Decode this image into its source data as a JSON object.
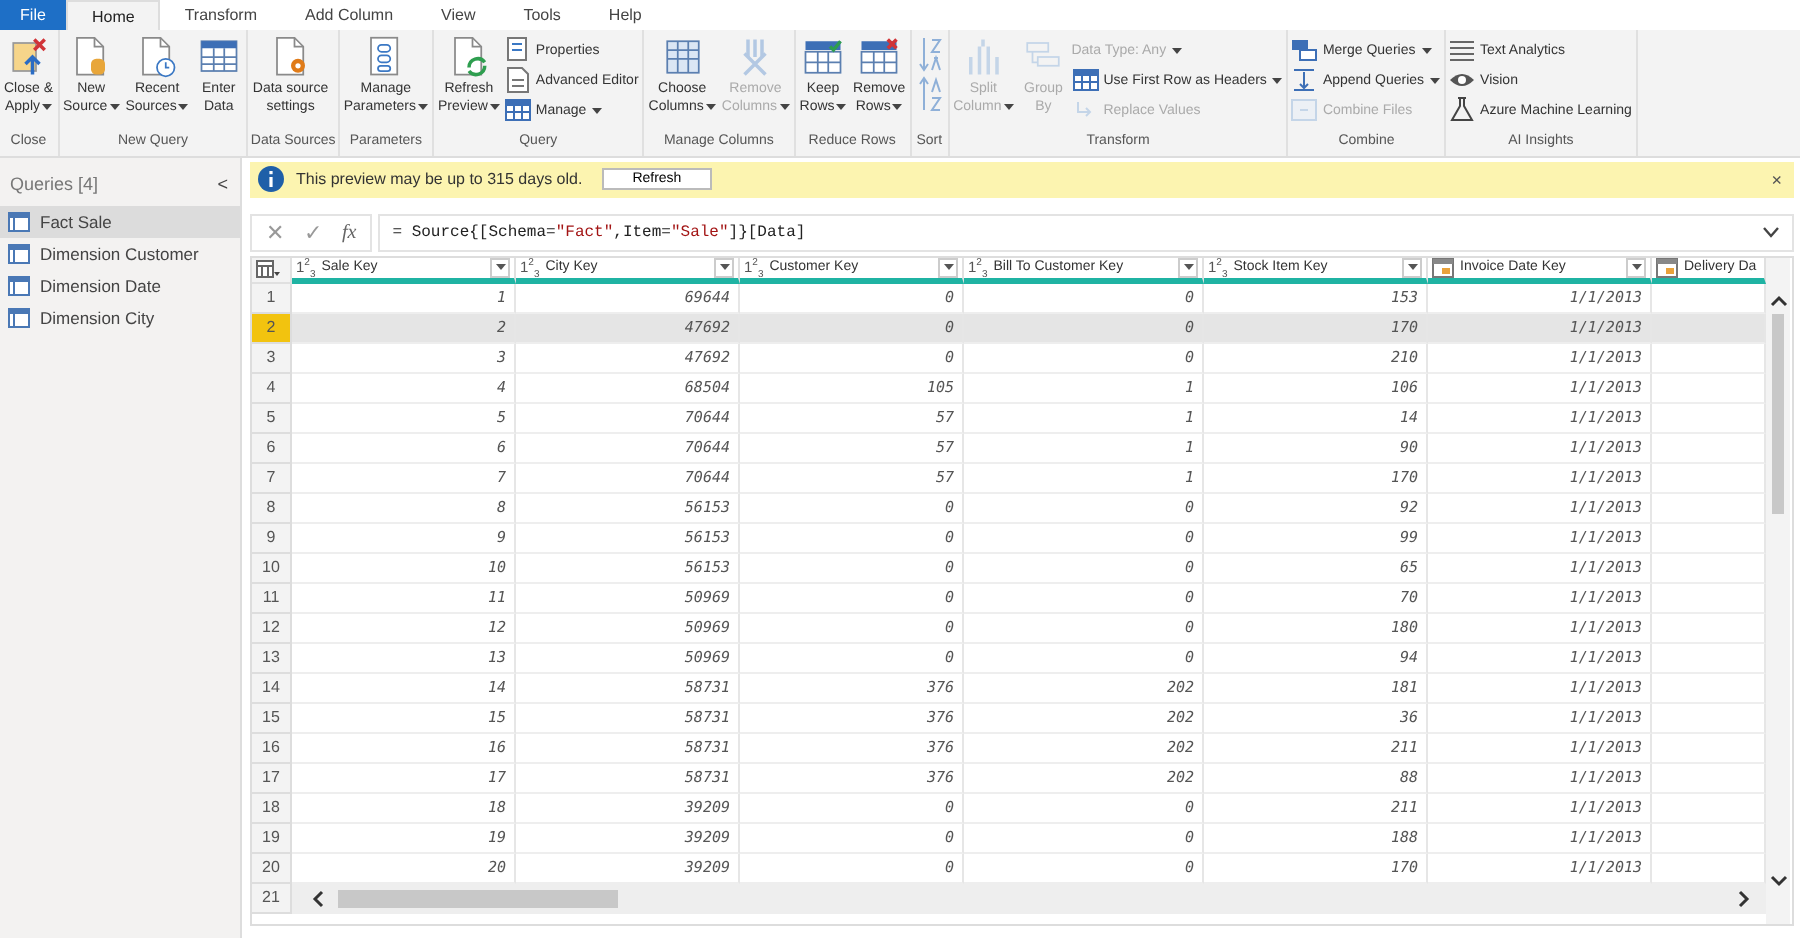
{
  "menu_tabs": [
    {
      "label": "File",
      "kind": "file",
      "selected": false
    },
    {
      "label": "Home",
      "kind": "tab",
      "selected": true
    },
    {
      "label": "Transform",
      "kind": "tab",
      "selected": false
    },
    {
      "label": "Add Column",
      "kind": "tab",
      "selected": false
    },
    {
      "label": "View",
      "kind": "tab",
      "selected": false
    },
    {
      "label": "Tools",
      "kind": "tab",
      "selected": false
    },
    {
      "label": "Help",
      "kind": "tab",
      "selected": false
    }
  ],
  "ribbon": {
    "groups": [
      {
        "label": "Close",
        "items": [
          {
            "kind": "large",
            "label": "Close &\nApply",
            "dropdown": true,
            "disabled": false
          }
        ]
      },
      {
        "label": "New Query",
        "items": [
          {
            "kind": "large",
            "label": "New\nSource",
            "dropdown": true,
            "disabled": false
          },
          {
            "kind": "large",
            "label": "Recent\nSources",
            "dropdown": true,
            "disabled": false
          },
          {
            "kind": "large",
            "label": "Enter\nData",
            "dropdown": false,
            "disabled": false
          }
        ]
      },
      {
        "label": "Data Sources",
        "items": [
          {
            "kind": "large",
            "label": "Data source\nsettings",
            "dropdown": false,
            "disabled": false
          }
        ]
      },
      {
        "label": "Parameters",
        "items": [
          {
            "kind": "large",
            "label": "Manage\nParameters",
            "dropdown": true,
            "disabled": false
          }
        ]
      },
      {
        "label": "Query",
        "items": [
          {
            "kind": "large",
            "label": "Refresh\nPreview",
            "dropdown": true,
            "disabled": false
          },
          {
            "kind": "stack",
            "items": [
              {
                "label": "Properties",
                "dropdown": false,
                "disabled": false
              },
              {
                "label": "Advanced Editor",
                "dropdown": false,
                "disabled": false
              },
              {
                "label": "Manage",
                "dropdown": true,
                "disabled": false
              }
            ]
          }
        ]
      },
      {
        "label": "Manage Columns",
        "items": [
          {
            "kind": "large",
            "label": "Choose\nColumns",
            "dropdown": true,
            "disabled": false
          },
          {
            "kind": "large",
            "label": "Remove\nColumns",
            "dropdown": true,
            "disabled": true
          }
        ]
      },
      {
        "label": "Reduce Rows",
        "items": [
          {
            "kind": "large",
            "label": "Keep\nRows",
            "dropdown": true,
            "disabled": false
          },
          {
            "kind": "large",
            "label": "Remove\nRows",
            "dropdown": true,
            "disabled": false
          }
        ]
      },
      {
        "label": "Sort",
        "items": [
          {
            "kind": "sort"
          },
          {
            "kind": "sort"
          }
        ]
      },
      {
        "label": "Transform",
        "items": [
          {
            "kind": "large",
            "label": "Split\nColumn",
            "dropdown": true,
            "disabled": true
          },
          {
            "kind": "large",
            "label": "Group\nBy",
            "dropdown": false,
            "disabled": true
          },
          {
            "kind": "stack",
            "items": [
              {
                "label": "Data Type: Any",
                "dropdown": true,
                "disabled": true
              },
              {
                "label": "Use First Row as Headers",
                "dropdown": true,
                "disabled": false
              },
              {
                "label": "Replace Values",
                "dropdown": false,
                "disabled": true
              }
            ]
          }
        ]
      },
      {
        "label": "Combine",
        "items": [
          {
            "kind": "stack",
            "items": [
              {
                "label": "Merge Queries",
                "dropdown": true,
                "disabled": false
              },
              {
                "label": "Append Queries",
                "dropdown": true,
                "disabled": false
              },
              {
                "label": "Combine Files",
                "dropdown": false,
                "disabled": true
              }
            ]
          }
        ]
      },
      {
        "label": "AI Insights",
        "items": [
          {
            "kind": "stack",
            "items": [
              {
                "label": "Text Analytics",
                "dropdown": false,
                "disabled": false
              },
              {
                "label": "Vision",
                "dropdown": false,
                "disabled": false
              },
              {
                "label": "Azure Machine Learning",
                "dropdown": false,
                "disabled": false
              }
            ]
          }
        ]
      }
    ]
  },
  "sidebar": {
    "title": "Queries [4]",
    "collapse": "<",
    "items": [
      {
        "label": "Fact Sale",
        "selected": true
      },
      {
        "label": "Dimension Customer",
        "selected": false
      },
      {
        "label": "Dimension Date",
        "selected": false
      },
      {
        "label": "Dimension City",
        "selected": false
      }
    ]
  },
  "info_bar": {
    "message": "This preview may be up to 315 days old.",
    "button": "Refresh",
    "close": "×"
  },
  "formula_bar": {
    "buttons": [
      "✕",
      "✓",
      "fx"
    ],
    "tokens": [
      {
        "text": "= Source{[Schema=",
        "kind": "code"
      },
      {
        "text": "\"Fact\"",
        "kind": "string"
      },
      {
        "text": ",Item=",
        "kind": "code"
      },
      {
        "text": "\"Sale\"",
        "kind": "string"
      },
      {
        "text": "]}[Data]",
        "kind": "code"
      }
    ]
  },
  "table": {
    "columns": [
      {
        "name": "Sale Key",
        "kind": "number",
        "type_label": "1$^{2}$$_{3}$"
      },
      {
        "name": "City Key",
        "kind": "number",
        "type_label": "1$^{2}$$_{3}$"
      },
      {
        "name": "Customer Key",
        "kind": "number",
        "type_label": "1$^{2}$$_{3}$"
      },
      {
        "name": "Bill To Customer Key",
        "kind": "number",
        "type_label": "1$^{2}$$_{3}$"
      },
      {
        "name": "Stock Item Key",
        "kind": "number",
        "type_label": "1$^{2}$$_{3}$"
      },
      {
        "name": "Invoice Date Key",
        "kind": "date"
      },
      {
        "name": "Delivery Da",
        "kind": "date"
      }
    ],
    "rows": [
      {
        "number": "1",
        "selected": false,
        "cells": [
          "1",
          "69644",
          "0",
          "0",
          "153",
          "1/1/2013"
        ]
      },
      {
        "number": "2",
        "selected": true,
        "cells": [
          "2",
          "47692",
          "0",
          "0",
          "170",
          "1/1/2013"
        ]
      },
      {
        "number": "3",
        "selected": false,
        "cells": [
          "3",
          "47692",
          "0",
          "0",
          "210",
          "1/1/2013"
        ]
      },
      {
        "number": "4",
        "selected": false,
        "cells": [
          "4",
          "68504",
          "105",
          "1",
          "106",
          "1/1/2013"
        ]
      },
      {
        "number": "5",
        "selected": false,
        "cells": [
          "5",
          "70644",
          "57",
          "1",
          "14",
          "1/1/2013"
        ]
      },
      {
        "number": "6",
        "selected": false,
        "cells": [
          "6",
          "70644",
          "57",
          "1",
          "90",
          "1/1/2013"
        ]
      },
      {
        "number": "7",
        "selected": false,
        "cells": [
          "7",
          "70644",
          "57",
          "1",
          "170",
          "1/1/2013"
        ]
      },
      {
        "number": "8",
        "selected": false,
        "cells": [
          "8",
          "56153",
          "0",
          "0",
          "92",
          "1/1/2013"
        ]
      },
      {
        "number": "9",
        "selected": false,
        "cells": [
          "9",
          "56153",
          "0",
          "0",
          "99",
          "1/1/2013"
        ]
      },
      {
        "number": "10",
        "selected": false,
        "cells": [
          "10",
          "56153",
          "0",
          "0",
          "65",
          "1/1/2013"
        ]
      },
      {
        "number": "11",
        "selected": false,
        "cells": [
          "11",
          "50969",
          "0",
          "0",
          "70",
          "1/1/2013"
        ]
      },
      {
        "number": "12",
        "selected": false,
        "cells": [
          "12",
          "50969",
          "0",
          "0",
          "180",
          "1/1/2013"
        ]
      },
      {
        "number": "13",
        "selected": false,
        "cells": [
          "13",
          "50969",
          "0",
          "0",
          "94",
          "1/1/2013"
        ]
      },
      {
        "number": "14",
        "selected": false,
        "cells": [
          "14",
          "58731",
          "376",
          "202",
          "181",
          "1/1/2013"
        ]
      },
      {
        "number": "15",
        "selected": false,
        "cells": [
          "15",
          "58731",
          "376",
          "202",
          "36",
          "1/1/2013"
        ]
      },
      {
        "number": "16",
        "selected": false,
        "cells": [
          "16",
          "58731",
          "376",
          "202",
          "211",
          "1/1/2013"
        ]
      },
      {
        "number": "17",
        "selected": false,
        "cells": [
          "17",
          "58731",
          "376",
          "202",
          "88",
          "1/1/2013"
        ]
      },
      {
        "number": "18",
        "selected": false,
        "cells": [
          "18",
          "39209",
          "0",
          "0",
          "211",
          "1/1/2013"
        ]
      },
      {
        "number": "19",
        "selected": false,
        "cells": [
          "19",
          "39209",
          "0",
          "0",
          "188",
          "1/1/2013"
        ]
      },
      {
        "number": "20",
        "selected": false,
        "cells": [
          "20",
          "39209",
          "0",
          "0",
          "170",
          "1/1/2013"
        ]
      },
      {
        "number": "21",
        "selected": false
      }
    ]
  }
}
